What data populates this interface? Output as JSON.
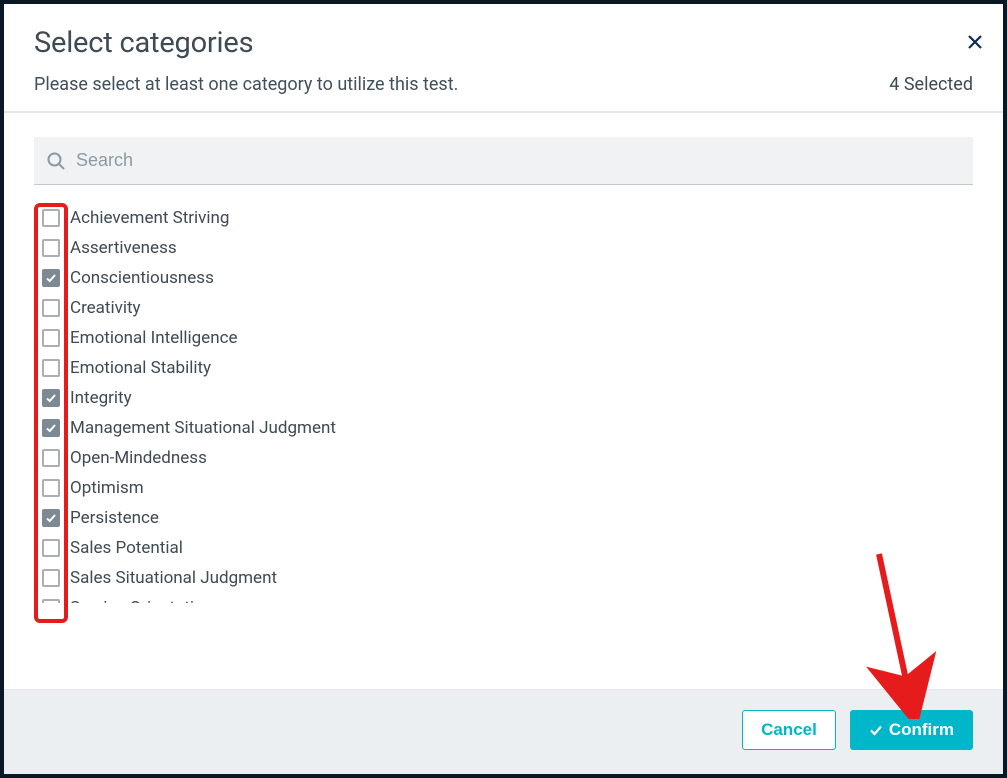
{
  "modal": {
    "title": "Select categories",
    "subtitle": "Please select at least one category to utilize this test.",
    "selected_label": "4 Selected"
  },
  "search": {
    "placeholder": "Search",
    "value": ""
  },
  "categories": [
    {
      "label": "Achievement Striving",
      "checked": false
    },
    {
      "label": "Assertiveness",
      "checked": false
    },
    {
      "label": "Conscientiousness",
      "checked": true
    },
    {
      "label": "Creativity",
      "checked": false
    },
    {
      "label": "Emotional Intelligence",
      "checked": false
    },
    {
      "label": "Emotional Stability",
      "checked": false
    },
    {
      "label": "Integrity",
      "checked": true
    },
    {
      "label": "Management Situational Judgment",
      "checked": true
    },
    {
      "label": "Open-Mindedness",
      "checked": false
    },
    {
      "label": "Optimism",
      "checked": false
    },
    {
      "label": "Persistence",
      "checked": true
    },
    {
      "label": "Sales Potential",
      "checked": false
    },
    {
      "label": "Sales Situational Judgment",
      "checked": false
    },
    {
      "label": "Service Orientation",
      "checked": false
    }
  ],
  "footer": {
    "cancel": "Cancel",
    "confirm": "Confirm"
  },
  "annotations": {
    "checkbox_highlight_color": "#e61c1c",
    "arrow_color": "#e61c1c"
  }
}
